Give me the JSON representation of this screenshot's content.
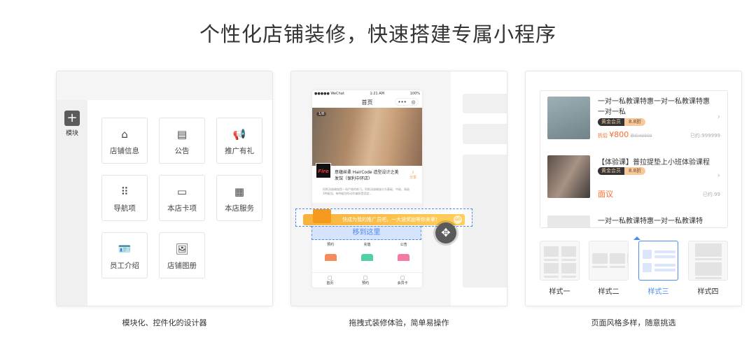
{
  "headline": "个性化店铺装修，快速搭建专属小程序",
  "panels": [
    {
      "caption": "模块化、控件化的设计器",
      "sidebar": {
        "add_label": "模块"
      },
      "modules": [
        {
          "label": "店铺信息",
          "icon": "store-icon"
        },
        {
          "label": "公告",
          "icon": "notice-icon"
        },
        {
          "label": "推广有礼",
          "icon": "megaphone-icon"
        },
        {
          "label": "导航项",
          "icon": "grid-dots-icon"
        },
        {
          "label": "本店卡项",
          "icon": "card-icon"
        },
        {
          "label": "本店服务",
          "icon": "apps-icon"
        },
        {
          "label": "员工介绍",
          "icon": "id-card-icon"
        },
        {
          "label": "店铺图册",
          "icon": "image-icon"
        }
      ]
    },
    {
      "caption": "拖拽式装修体验，简单易操作",
      "phone": {
        "status_carrier": "●●●●● WeChat",
        "status_time": "1:21 AM",
        "status_battery": "100%",
        "nav_title": "首页",
        "photo_counter": "1/8",
        "store_logo": "Fire",
        "store_name": "意蕴丝柔 HairCode 造型设计之美发馆（保利中环店）",
        "share_label": "分享",
        "desc": "阿斯汤伽瑜伽是一场严格的练习。阿斯汤伽瑜伽分为基础、中级、高级3种级别。每种级别的动作编排是固定...",
        "promo_banner": "快成为我的推广员吧，一大波奖励等你来拿！",
        "promo_go": "GO",
        "drop_hint": "移到这里",
        "icons": [
          {
            "label": "预约",
            "color": "#f0b060"
          },
          {
            "label": "充值",
            "color": "#f7a940"
          },
          {
            "label": "公告",
            "color": "#5ab4f0"
          }
        ],
        "icons_row2_colors": [
          "#f58a5a",
          "#4fd0a8",
          "#f57aa0"
        ],
        "tabs": [
          "首页",
          "预约",
          "会员卡"
        ]
      }
    },
    {
      "caption": "页面风格多样，随意挑选",
      "items": [
        {
          "title": "一对一私教课特惠一对一私教课特惠一对一私",
          "badge_a": "黄金会员",
          "badge_b": "8.8折",
          "price_prefix": "折后",
          "price": "¥800",
          "orig_price": "原价¥9999",
          "sold": "已约:999999"
        },
        {
          "title": "【体验课】普拉提垫上小班体验课程",
          "badge_a": "黄金会员",
          "badge_b": "8.8折",
          "price": "面议",
          "sold": "已约:99"
        },
        {
          "title": "一对一私教课特惠一对一私教课特"
        }
      ],
      "styles": [
        {
          "label": "样式一",
          "selected": false
        },
        {
          "label": "样式二",
          "selected": false
        },
        {
          "label": "样式三",
          "selected": true
        },
        {
          "label": "样式四",
          "selected": false
        }
      ],
      "accent": "#4d8bf5",
      "price_color": "#ff6a2a"
    }
  ]
}
